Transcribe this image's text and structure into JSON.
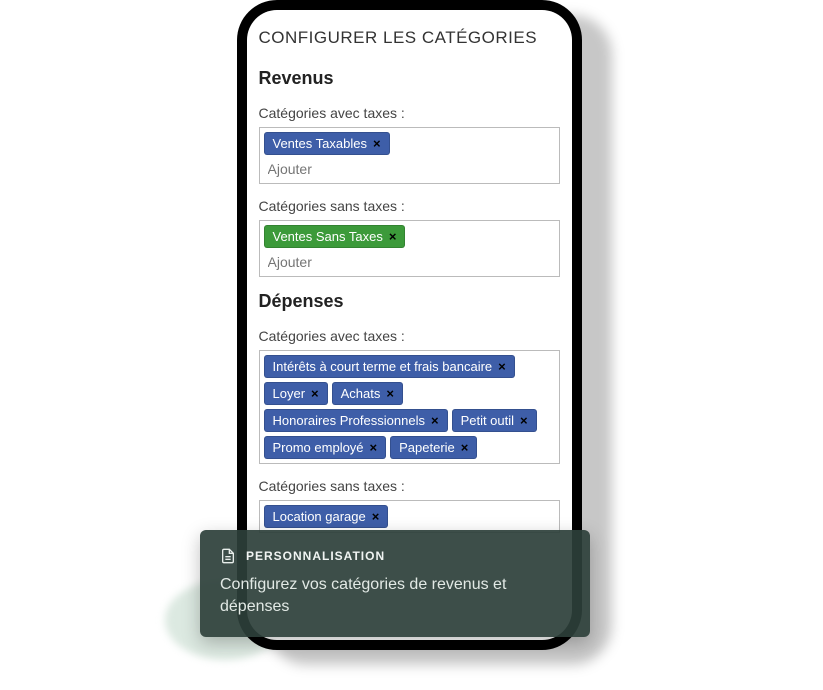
{
  "page_title": "CONFIGURER LES CATÉGORIES",
  "sections": {
    "revenus": {
      "heading": "Revenus",
      "with_taxes": {
        "label": "Catégories avec taxes :",
        "tags": [
          "Ventes Taxables"
        ],
        "placeholder": "Ajouter"
      },
      "without_taxes": {
        "label": "Catégories sans taxes :",
        "tags": [
          "Ventes Sans Taxes"
        ],
        "placeholder": "Ajouter"
      }
    },
    "depenses": {
      "heading": "Dépenses",
      "with_taxes": {
        "label": "Catégories avec taxes :",
        "tags": [
          "Intérêts à court terme et frais bancaire",
          "Loyer",
          "Achats",
          "Honoraires Professionnels",
          "Petit outil",
          "Promo employé",
          "Papeterie"
        ]
      },
      "without_taxes": {
        "label": "Catégories sans taxes :",
        "tags": [
          "Location garage"
        ]
      }
    }
  },
  "overlay": {
    "title": "PERSONNALISATION",
    "description": "Configurez vos catégories de revenus et dépenses"
  },
  "remove_glyph": "×"
}
